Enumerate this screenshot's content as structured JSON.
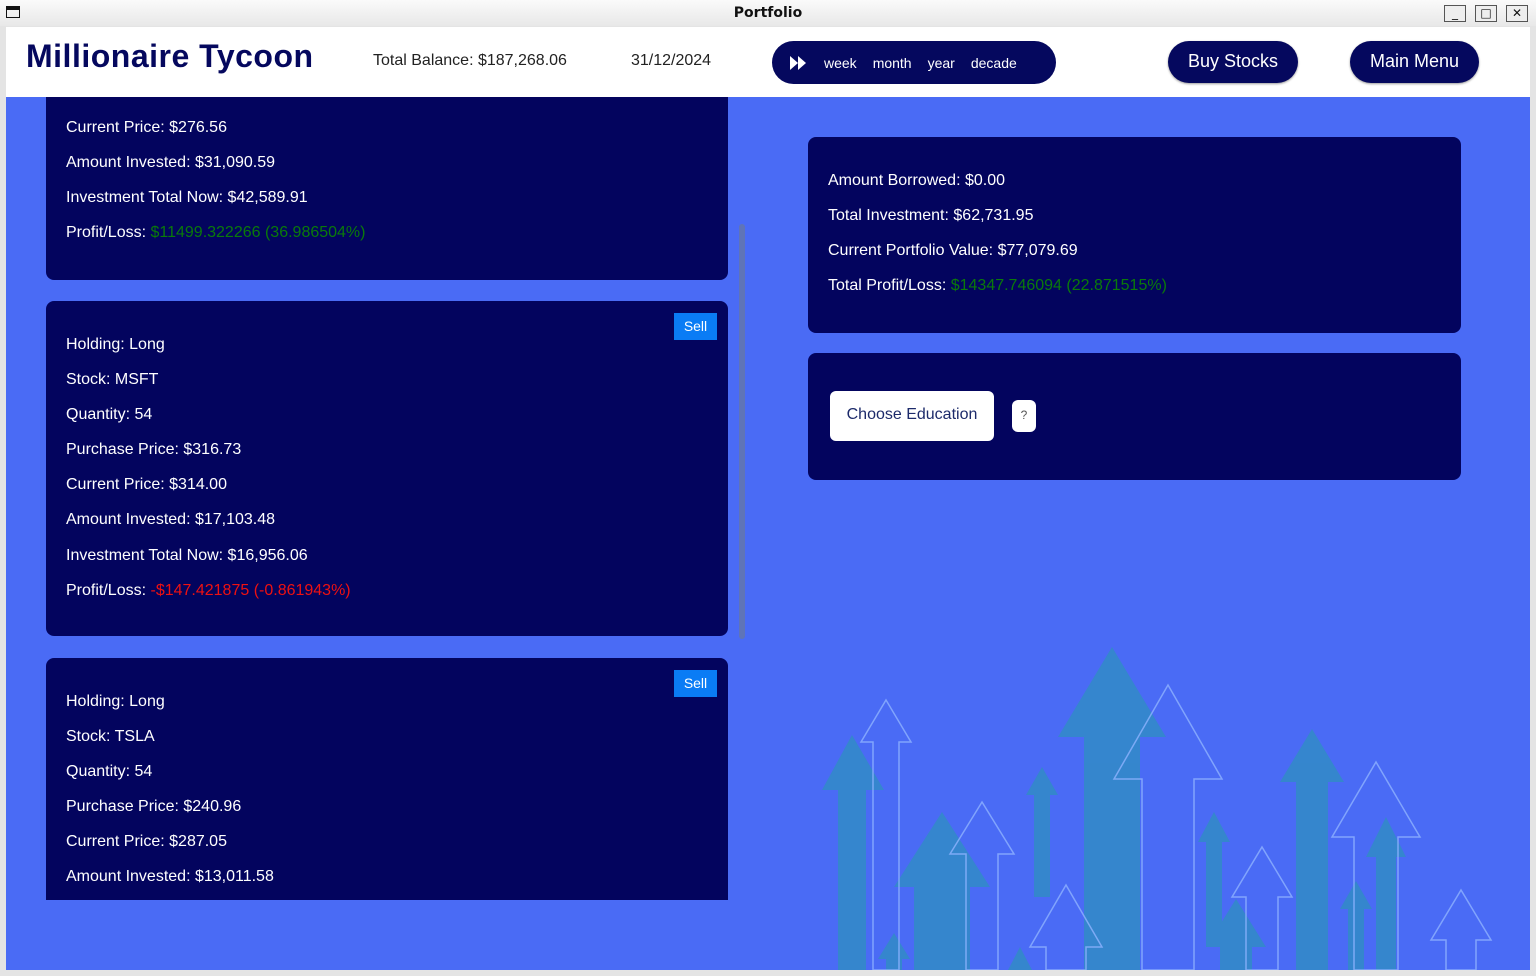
{
  "window": {
    "title": "Portfolio",
    "minimize": "_",
    "maximize": "□",
    "close": "✕"
  },
  "header": {
    "app_title": "Millionaire Tycoon",
    "total_balance": "Total Balance: $187,268.06",
    "date": "31/12/2024",
    "speed_options": [
      "week",
      "month",
      "year",
      "decade"
    ],
    "buy_stocks": "Buy Stocks",
    "main_menu": "Main Menu"
  },
  "holdings": [
    {
      "current_price": "Current Price: $276.56",
      "amount_invested": "Amount Invested: $31,090.59",
      "total_now": "Investment Total Now: $42,589.91",
      "profit_label": "Profit/Loss: ",
      "profit_value": "$11499.322266 (36.986504%)"
    },
    {
      "sell": "Sell",
      "holding": "Holding: Long",
      "stock": "Stock: MSFT",
      "quantity": "Quantity: 54",
      "purchase_price": "Purchase Price: $316.73",
      "current_price": "Current Price: $314.00",
      "amount_invested": "Amount Invested: $17,103.48",
      "total_now": "Investment Total Now: $16,956.06",
      "profit_label": "Profit/Loss: ",
      "profit_value": "-$147.421875 (-0.861943%)"
    },
    {
      "sell": "Sell",
      "holding": "Holding: Long",
      "stock": "Stock: TSLA",
      "quantity": "Quantity: 54",
      "purchase_price": "Purchase Price: $240.96",
      "current_price": "Current Price: $287.05",
      "amount_invested": "Amount Invested: $13,011.58"
    }
  ],
  "summary": {
    "borrowed": "Amount Borrowed: $0.00",
    "total_investment": "Total Investment: $62,731.95",
    "portfolio_value": "Current Portfolio Value: $77,079.69",
    "profit_label": "Total Profit/Loss: ",
    "profit_value": "$14347.746094 (22.871515%)"
  },
  "education": {
    "button": "Choose Education",
    "help": "?"
  },
  "colors": {
    "navy": "#03045e",
    "background": "#4a6bf5",
    "profit": "#0a7a0a",
    "loss": "#ee1111",
    "sell": "#0a7cf5"
  }
}
